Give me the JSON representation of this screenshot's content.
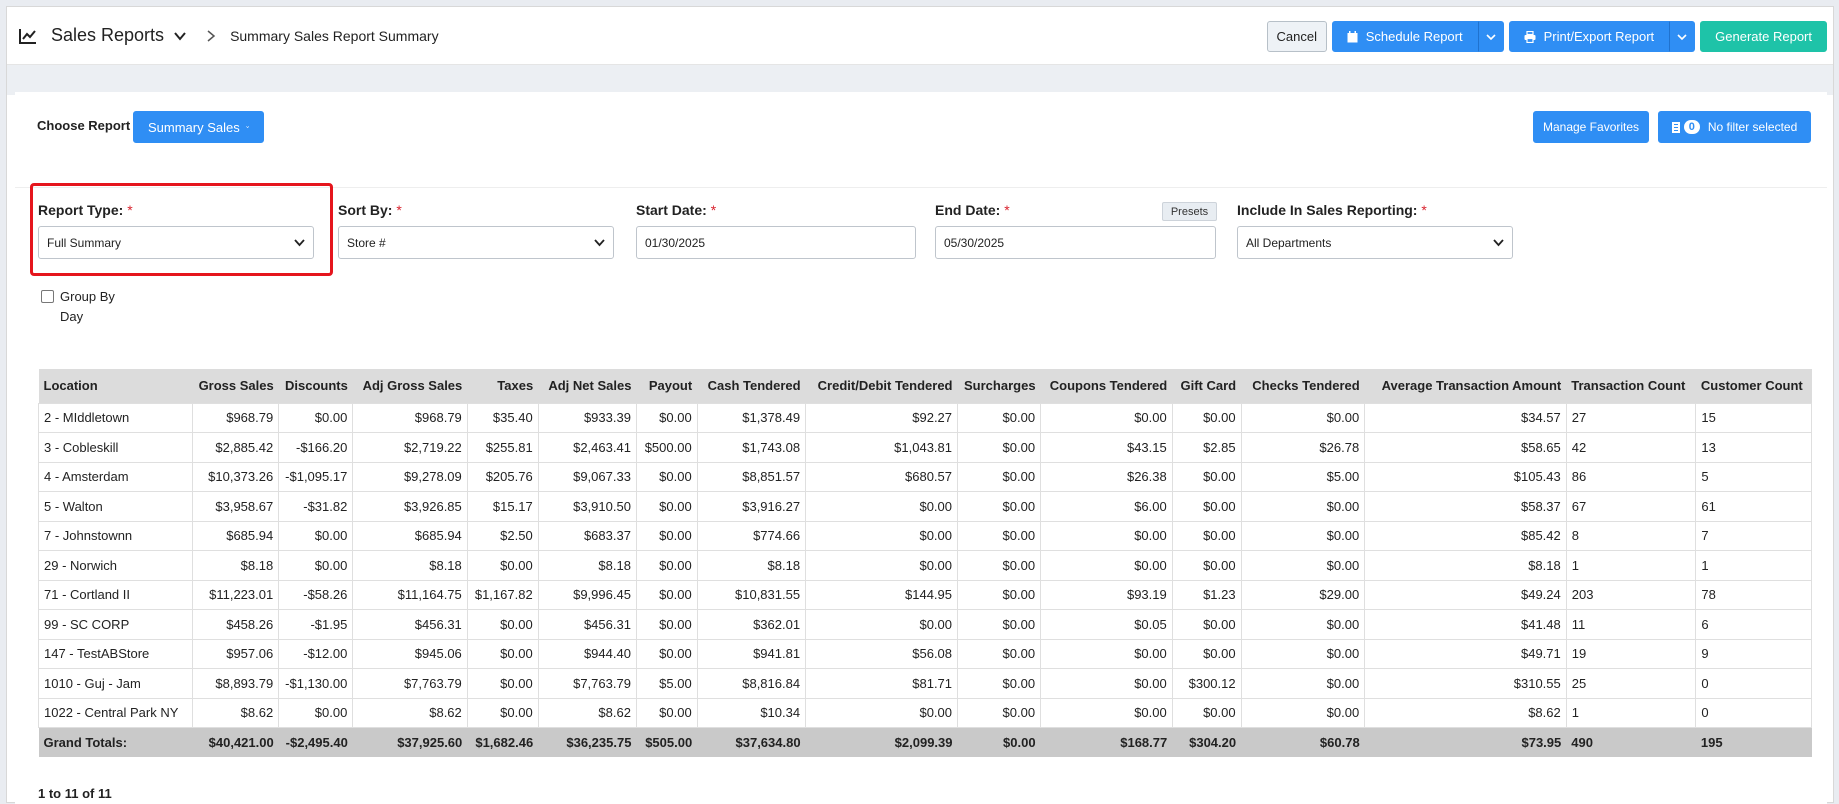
{
  "header": {
    "title": "Sales Reports",
    "breadcrumb": "Summary Sales Report Summary",
    "cancel_label": "Cancel",
    "schedule_label": "Schedule Report",
    "print_label": "Print/Export Report",
    "generate_label": "Generate Report"
  },
  "choose": {
    "label": "Choose Report",
    "report": "Summary Sales",
    "manage_label": "Manage Favorites",
    "filter_count": "0",
    "filter_label": "No filter selected"
  },
  "form": {
    "report_type_label": "Report Type:",
    "report_type_value": "Full Summary",
    "sort_by_label": "Sort By:",
    "sort_by_value": "Store #",
    "start_date_label": "Start Date:",
    "start_date_value": "01/30/2025",
    "end_date_label": "End Date:",
    "end_date_value": "05/30/2025",
    "presets_label": "Presets",
    "include_label": "Include In Sales Reporting:",
    "include_value": "All Departments",
    "required_mark": "*",
    "group_by_day_label": "Group By Day"
  },
  "table": {
    "headers": [
      "Location",
      "Gross Sales",
      "Discounts",
      "Adj Gross Sales",
      "Taxes",
      "Adj Net Sales",
      "Payout",
      "Cash Tendered",
      "Credit/Debit Tendered",
      "Surcharges",
      "Coupons Tendered",
      "Gift Card",
      "Checks Tendered",
      "Average Transaction Amount",
      "Transaction Count",
      "Customer Count"
    ],
    "rows": [
      [
        "2 - MIddletown",
        "$968.79",
        "$0.00",
        "$968.79",
        "$35.40",
        "$933.39",
        "$0.00",
        "$1,378.49",
        "$92.27",
        "$0.00",
        "$0.00",
        "$0.00",
        "$0.00",
        "$34.57",
        "27",
        "15"
      ],
      [
        "3 - Cobleskill",
        "$2,885.42",
        "-$166.20",
        "$2,719.22",
        "$255.81",
        "$2,463.41",
        "$500.00",
        "$1,743.08",
        "$1,043.81",
        "$0.00",
        "$43.15",
        "$2.85",
        "$26.78",
        "$58.65",
        "42",
        "13"
      ],
      [
        "4 - Amsterdam",
        "$10,373.26",
        "-$1,095.17",
        "$9,278.09",
        "$205.76",
        "$9,067.33",
        "$0.00",
        "$8,851.57",
        "$680.57",
        "$0.00",
        "$26.38",
        "$0.00",
        "$5.00",
        "$105.43",
        "86",
        "5"
      ],
      [
        "5 - Walton",
        "$3,958.67",
        "-$31.82",
        "$3,926.85",
        "$15.17",
        "$3,910.50",
        "$0.00",
        "$3,916.27",
        "$0.00",
        "$0.00",
        "$6.00",
        "$0.00",
        "$0.00",
        "$58.37",
        "67",
        "61"
      ],
      [
        "7 - Johnstownn",
        "$685.94",
        "$0.00",
        "$685.94",
        "$2.50",
        "$683.37",
        "$0.00",
        "$774.66",
        "$0.00",
        "$0.00",
        "$0.00",
        "$0.00",
        "$0.00",
        "$85.42",
        "8",
        "7"
      ],
      [
        "29 - Norwich",
        "$8.18",
        "$0.00",
        "$8.18",
        "$0.00",
        "$8.18",
        "$0.00",
        "$8.18",
        "$0.00",
        "$0.00",
        "$0.00",
        "$0.00",
        "$0.00",
        "$8.18",
        "1",
        "1"
      ],
      [
        "71 - Cortland II",
        "$11,223.01",
        "-$58.26",
        "$11,164.75",
        "$1,167.82",
        "$9,996.45",
        "$0.00",
        "$10,831.55",
        "$144.95",
        "$0.00",
        "$93.19",
        "$1.23",
        "$29.00",
        "$49.24",
        "203",
        "78"
      ],
      [
        "99 - SC CORP",
        "$458.26",
        "-$1.95",
        "$456.31",
        "$0.00",
        "$456.31",
        "$0.00",
        "$362.01",
        "$0.00",
        "$0.00",
        "$0.05",
        "$0.00",
        "$0.00",
        "$41.48",
        "11",
        "6"
      ],
      [
        "147 - TestABStore",
        "$957.06",
        "-$12.00",
        "$945.06",
        "$0.00",
        "$944.40",
        "$0.00",
        "$941.81",
        "$56.08",
        "$0.00",
        "$0.00",
        "$0.00",
        "$0.00",
        "$49.71",
        "19",
        "9"
      ],
      [
        "1010 - Guj - Jam",
        "$8,893.79",
        "-$1,130.00",
        "$7,763.79",
        "$0.00",
        "$7,763.79",
        "$5.00",
        "$8,816.84",
        "$81.71",
        "$0.00",
        "$0.00",
        "$300.12",
        "$0.00",
        "$310.55",
        "25",
        "0"
      ],
      [
        "1022 - Central Park NY",
        "$8.62",
        "$0.00",
        "$8.62",
        "$0.00",
        "$8.62",
        "$0.00",
        "$10.34",
        "$0.00",
        "$0.00",
        "$0.00",
        "$0.00",
        "$0.00",
        "$8.62",
        "1",
        "0"
      ]
    ],
    "totals": [
      "Grand Totals:",
      "$40,421.00",
      "-$2,495.40",
      "$37,925.60",
      "$1,682.46",
      "$36,235.75",
      "$505.00",
      "$37,634.80",
      "$2,099.39",
      "$0.00",
      "$168.77",
      "$304.20",
      "$60.78",
      "$73.95",
      "490",
      "195"
    ],
    "pager": "1 to 11 of 11"
  }
}
